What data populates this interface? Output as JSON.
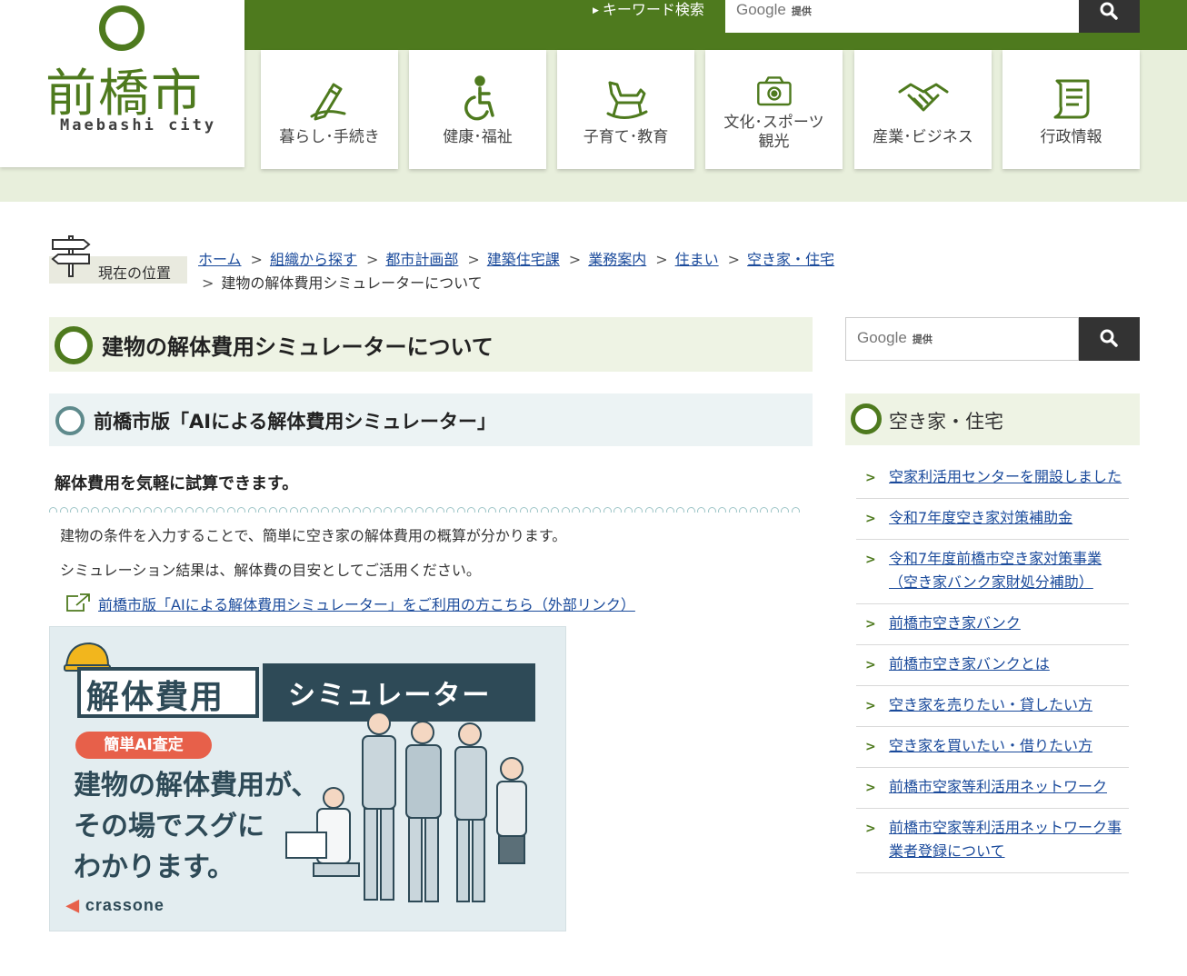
{
  "header": {
    "logo_kanji": "前橋市",
    "logo_roman": "Maebashi city",
    "keyword_label": "キーワード検索",
    "search_provider": "Google",
    "search_provider_note": "提供"
  },
  "nav": [
    {
      "label": "暮らし･手続き",
      "icon": "pen-icon"
    },
    {
      "label": "健康･福祉",
      "icon": "wheelchair-icon"
    },
    {
      "label": "子育て･教育",
      "icon": "rocking-horse-icon"
    },
    {
      "label": "文化･スポーツ",
      "label2": "観光",
      "icon": "camera-icon"
    },
    {
      "label": "産業･ビジネス",
      "icon": "handshake-icon"
    },
    {
      "label": "行政情報",
      "icon": "document-icon"
    }
  ],
  "breadcrumb": {
    "label": "現在の位置",
    "items": [
      "ホーム",
      "組織から探す",
      "都市計画部",
      "建築住宅課",
      "業務案内",
      "住まい",
      "空き家・住宅"
    ],
    "current": "建物の解体費用シミュレーターについて"
  },
  "main": {
    "title": "建物の解体費用シミュレーターについて",
    "subtitle": "前橋市版「AIによる解体費用シミュレーター」",
    "lead": "解体費用を気軽に試算できます。",
    "para1": "建物の条件を入力することで、簡単に空き家の解体費用の概算が分かります。",
    "para2": "シミュレーション結果は、解体費の目安としてご活用ください。",
    "ext_link": "前橋市版「AIによる解体費用シミュレーター」をご利用の方こちら（外部リンク）"
  },
  "banner": {
    "title": "解体費用",
    "title2": "シミュレーター",
    "pill": "簡単AI査定",
    "copy1": "建物の解体費用が、",
    "copy2": "その場でスグに",
    "copy3": "わかります。",
    "brand": "crassone"
  },
  "sidebar": {
    "search_provider": "Google",
    "search_provider_note": "提供",
    "heading": "空き家・住宅",
    "links": [
      "空家利活用センターを開設しました",
      "令和7年度空き家対策補助金",
      "令和7年度前橋市空き家対策事業（空き家バンク家財処分補助）",
      "前橋市空き家バンク",
      "前橋市空き家バンクとは",
      "空き家を売りたい・貸したい方",
      "空き家を買いたい・借りたい方",
      "前橋市空家等利活用ネットワーク",
      "前橋市空家等利活用ネットワーク事業者登録について"
    ]
  },
  "colors": {
    "brand_green": "#4e7a1e",
    "link": "#1a4a9b",
    "dark": "#333333",
    "banner_navy": "#2e4a57",
    "banner_red": "#e7604a"
  }
}
